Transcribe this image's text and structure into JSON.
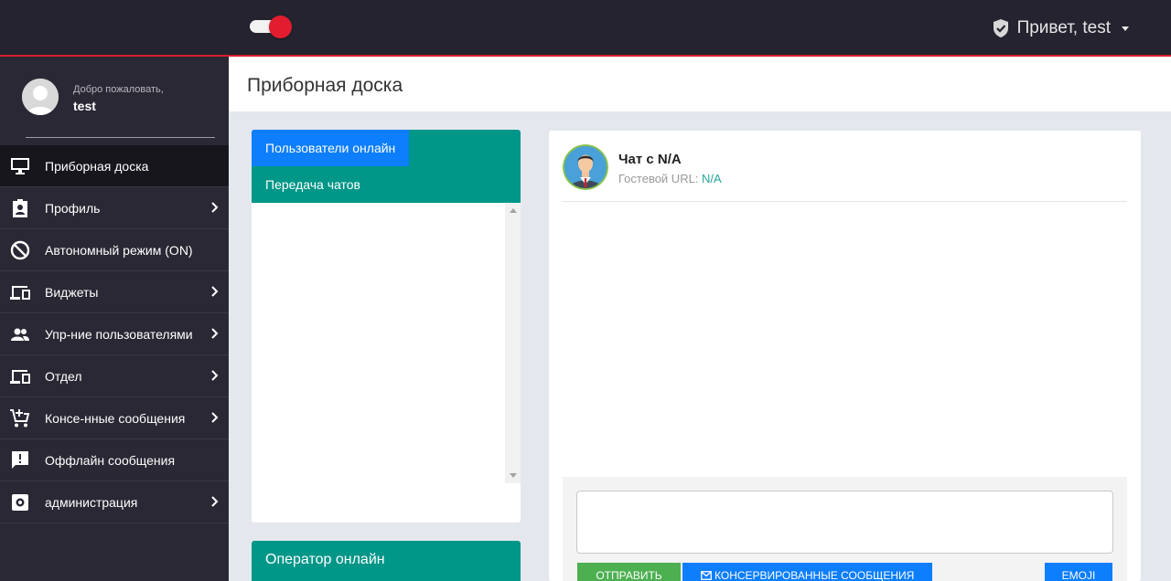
{
  "topbar": {
    "greeting": "Привет, test",
    "toggle_on": true
  },
  "sidebar": {
    "welcome": "Добро пожаловать,",
    "username": "test",
    "items": [
      {
        "label": "Приборная доска",
        "icon": "monitor-icon",
        "active": true,
        "chevron": false
      },
      {
        "label": "Профиль",
        "icon": "badge-icon",
        "active": false,
        "chevron": true
      },
      {
        "label": "Автономный режим (ON)",
        "icon": "block-icon",
        "active": false,
        "chevron": false
      },
      {
        "label": "Виджеты",
        "icon": "devices-icon",
        "active": false,
        "chevron": true
      },
      {
        "label": "Упр-ние пользователями",
        "icon": "people-icon",
        "active": false,
        "chevron": true
      },
      {
        "label": "Отдел",
        "icon": "devices-icon",
        "active": false,
        "chevron": true
      },
      {
        "label": "Консе-нные сообщения",
        "icon": "cart-plus-icon",
        "active": false,
        "chevron": true
      },
      {
        "label": "Оффлайн сообщения",
        "icon": "feedback-icon",
        "active": false,
        "chevron": false
      },
      {
        "label": "администрация",
        "icon": "settings-icon",
        "active": false,
        "chevron": true
      }
    ]
  },
  "page": {
    "title": "Приборная доска"
  },
  "users_panel": {
    "tab_online": "Пользователи онлайн",
    "tab_transfer": "Передача чатов"
  },
  "operator_panel": {
    "title": "Оператор онлайн"
  },
  "chat": {
    "title": "Чат с N/A",
    "url_label": "Гостевой URL:",
    "url_value": "N/A",
    "send_label": "ОТПРАВИТЬ",
    "canned_label": "КОНСЕРВИРОВАННЫЕ СООБЩЕНИЯ",
    "emoji_label": "EMOJI"
  },
  "colors": {
    "topbar": "#25232f",
    "accent_red": "#d71f2e",
    "sidebar": "#2a2834",
    "teal": "#009688",
    "blue": "#0d7efc",
    "green": "#4caf50"
  }
}
